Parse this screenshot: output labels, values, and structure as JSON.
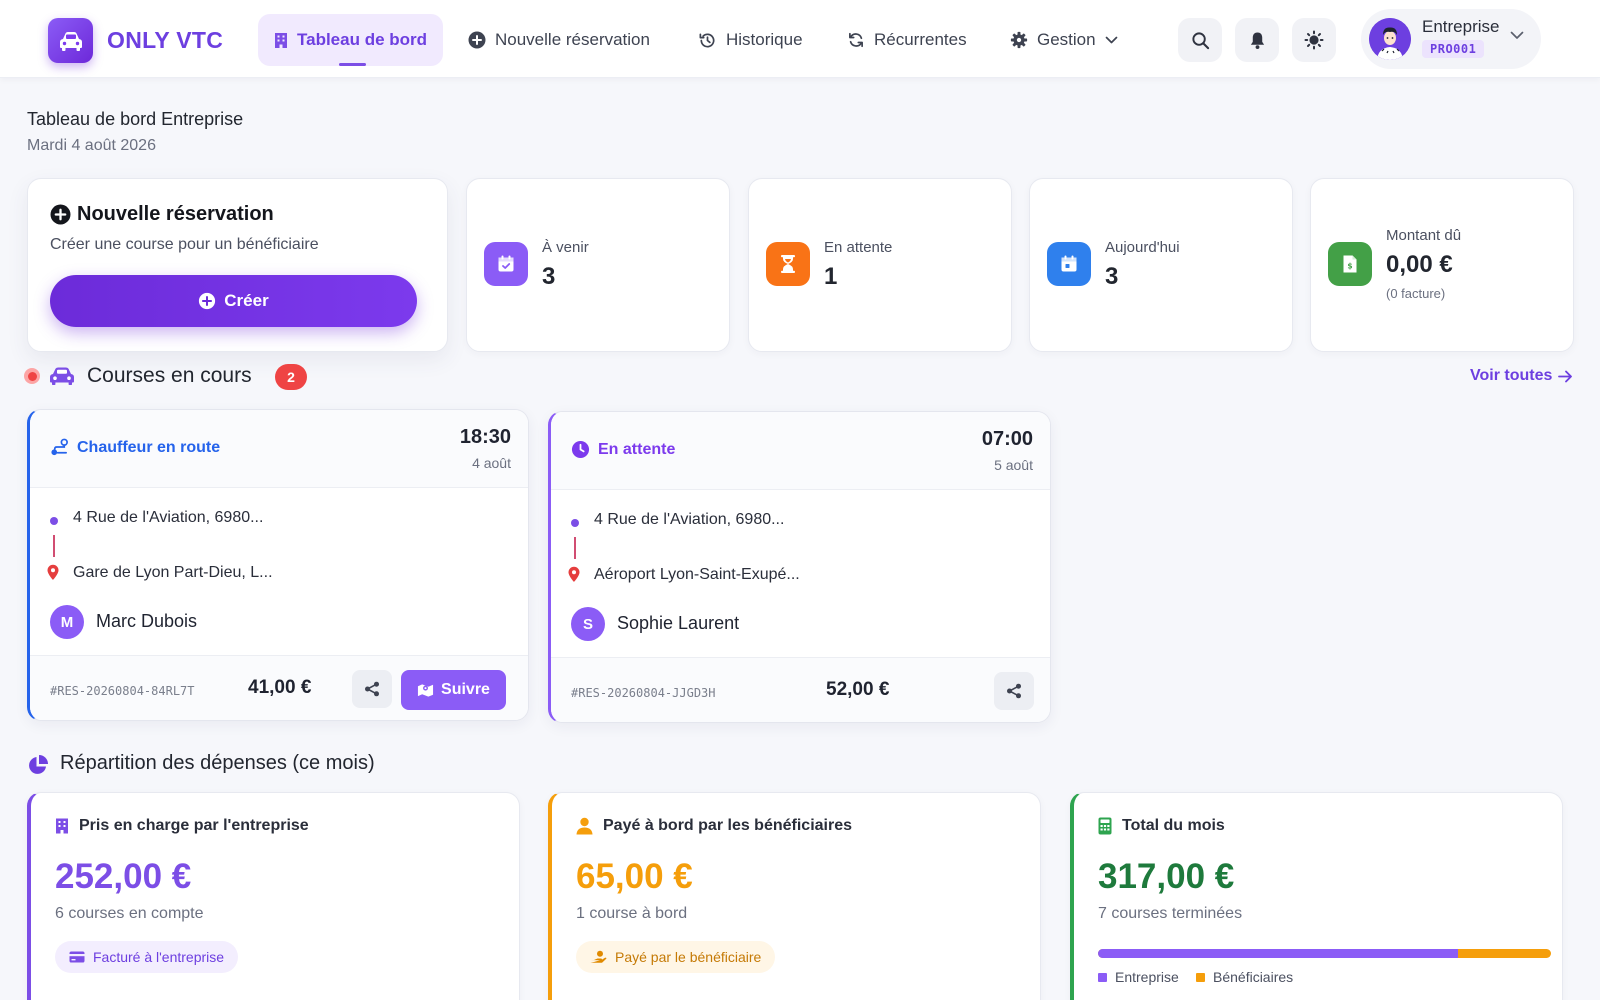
{
  "app": {
    "name": "ONLY VTC"
  },
  "nav": {
    "items": [
      {
        "label": "Tableau de bord",
        "icon": "building-icon"
      },
      {
        "label": "Nouvelle réservation",
        "icon": "plus-circle-icon"
      },
      {
        "label": "Historique",
        "icon": "history-icon"
      },
      {
        "label": "Récurrentes",
        "icon": "refresh-icon"
      },
      {
        "label": "Gestion",
        "icon": "gear-icon"
      }
    ]
  },
  "user": {
    "name": "Entreprise",
    "code": "PRO001"
  },
  "page": {
    "title": "Tableau de bord Entreprise",
    "date": "Mardi 4 août 2026"
  },
  "new_booking": {
    "title": "Nouvelle réservation",
    "subtitle": "Créer une course pour un bénéficiaire",
    "button": "Créer"
  },
  "stats": [
    {
      "label": "À venir",
      "value": "3",
      "color": "#8b5cf6",
      "icon": "calendar-check-icon"
    },
    {
      "label": "En attente",
      "value": "1",
      "color": "#f97316",
      "icon": "hourglass-icon"
    },
    {
      "label": "Aujourd'hui",
      "value": "3",
      "color": "#2f80ed",
      "icon": "calendar-day-icon"
    },
    {
      "label": "Montant dû",
      "value": "0,00 €",
      "note": "(0 facture)",
      "color": "#43a047",
      "icon": "invoice-icon"
    }
  ],
  "rides_section": {
    "title": "Courses en cours",
    "count": "2",
    "see_all": "Voir toutes"
  },
  "rides": [
    {
      "status": "Chauffeur en route",
      "status_color": "#2563eb",
      "time": "18:30",
      "day": "4 août",
      "from": "4 Rue de l'Aviation, 6980...",
      "to": "Gare de Lyon Part-Dieu, L...",
      "initial": "M",
      "passenger": "Marc Dubois",
      "ref": "#RES-20260804-84RL7T",
      "price": "41,00 €",
      "follow": "Suivre"
    },
    {
      "status": "En attente",
      "status_color": "#7c3aed",
      "time": "07:00",
      "day": "5 août",
      "from": "4 Rue de l'Aviation, 6980...",
      "to": "Aéroport Lyon-Saint-Exupé...",
      "initial": "S",
      "passenger": "Sophie Laurent",
      "ref": "#RES-20260804-JJGD3H",
      "price": "52,00 €"
    }
  ],
  "expenses_section": {
    "title": "Répartition des dépenses (ce mois)"
  },
  "expenses": [
    {
      "title": "Pris en charge par l'entreprise",
      "amount": "252,00 €",
      "sub": "6 courses en compte",
      "pill": "Facturé à l'entreprise",
      "color": "#7c4ee6"
    },
    {
      "title": "Payé à bord par les bénéficiaires",
      "amount": "65,00 €",
      "sub": "1 course à bord",
      "pill": "Payé par le bénéficiaire",
      "color": "#f59e0b"
    },
    {
      "title": "Total du mois",
      "amount": "317,00 €",
      "sub": "7 courses terminées",
      "color": "#1e7a3c",
      "split": {
        "company_share": 0.795,
        "legend_company": "Entreprise",
        "legend_beneficiaries": "Bénéficiaires"
      }
    }
  ]
}
